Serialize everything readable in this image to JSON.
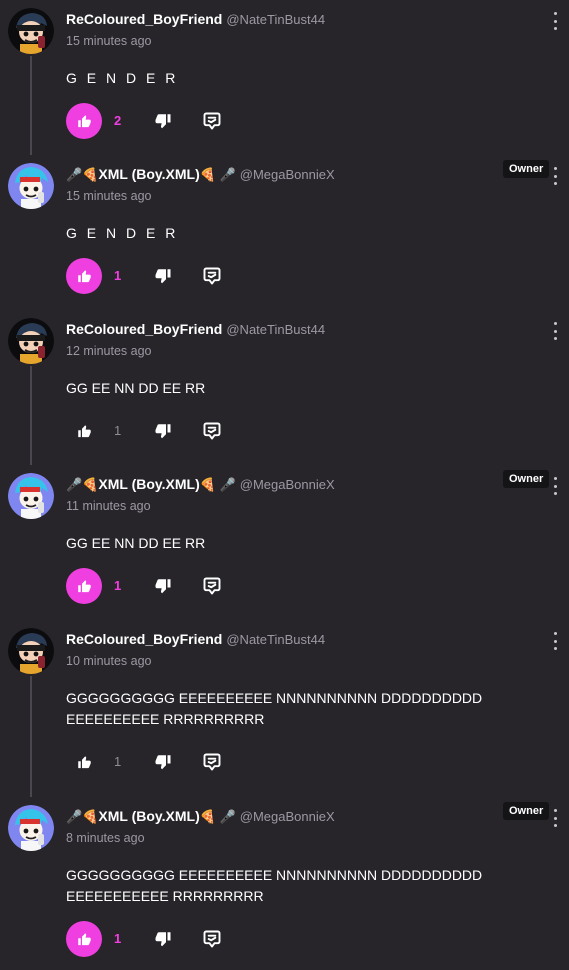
{
  "colors": {
    "accent": "#ef3fe0",
    "background": "#27252a",
    "muted": "#9c99a3"
  },
  "comments": [
    {
      "name": "ReColoured_BoyFriend",
      "handle": "@NateTinBust44",
      "time": "15 minutes ago",
      "text": "G E N D E R",
      "likes": "2",
      "liked": true,
      "owner": false,
      "avatar": "bf-dark",
      "name_prefix": "",
      "name_suffix": ""
    },
    {
      "name": "XML (Boy.XML)",
      "handle": "@MegaBonnieX",
      "time": "15 minutes ago",
      "text": "G E N D E R",
      "likes": "1",
      "liked": true,
      "owner": true,
      "owner_label": "Owner",
      "avatar": "bf-blue",
      "name_prefix": "🎤🍕",
      "name_suffix": "🍕 🎤"
    },
    {
      "name": "ReColoured_BoyFriend",
      "handle": "@NateTinBust44",
      "time": "12 minutes ago",
      "text": "GG EE NN DD EE RR",
      "likes": "1",
      "liked": false,
      "owner": false,
      "avatar": "bf-dark",
      "name_prefix": "",
      "name_suffix": ""
    },
    {
      "name": "XML (Boy.XML)",
      "handle": "@MegaBonnieX",
      "time": "11 minutes ago",
      "text": "GG EE NN DD EE RR",
      "likes": "1",
      "liked": true,
      "owner": true,
      "owner_label": "Owner",
      "avatar": "bf-blue",
      "name_prefix": "🎤🍕",
      "name_suffix": "🍕 🎤"
    },
    {
      "name": "ReColoured_BoyFriend",
      "handle": "@NateTinBust44",
      "time": "10 minutes ago",
      "text": "GGGGGGGGGG EEEEEEEEEE NNNNNNNNNN DDDDDDDDDD EEEEEEEEEE RRRRRRRRRR",
      "likes": "1",
      "liked": false,
      "owner": false,
      "avatar": "bf-dark",
      "name_prefix": "",
      "name_suffix": ""
    },
    {
      "name": "XML (Boy.XML)",
      "handle": "@MegaBonnieX",
      "time": "8 minutes ago",
      "text": "GGGGGGGGGG EEEEEEEEEE NNNNNNNNNN DDDDDDDDDD EEEEEEEEEEE RRRRRRRRR",
      "likes": "1",
      "liked": true,
      "owner": true,
      "owner_label": "Owner",
      "avatar": "bf-blue",
      "name_prefix": "🎤🍕",
      "name_suffix": "🍕 🎤"
    }
  ]
}
